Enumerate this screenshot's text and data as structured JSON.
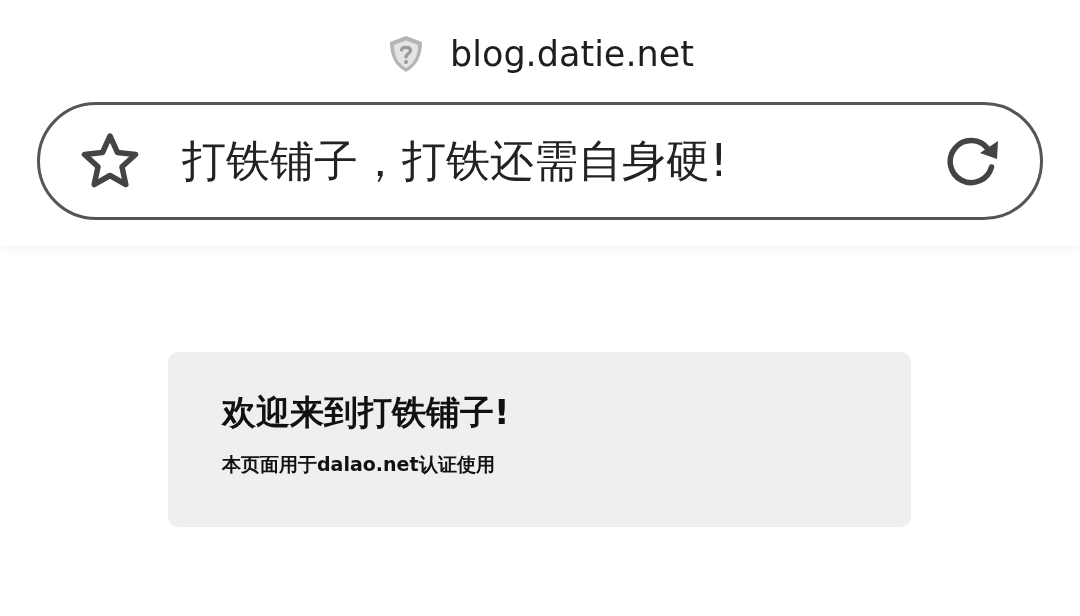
{
  "top_bar": {
    "domain": "blog.datie.net"
  },
  "address_bar": {
    "title": "打铁铺子，打铁还需自身硬!"
  },
  "card": {
    "heading": "欢迎来到打铁铺子!",
    "text": "本页面用于dalao.net认证使用"
  }
}
